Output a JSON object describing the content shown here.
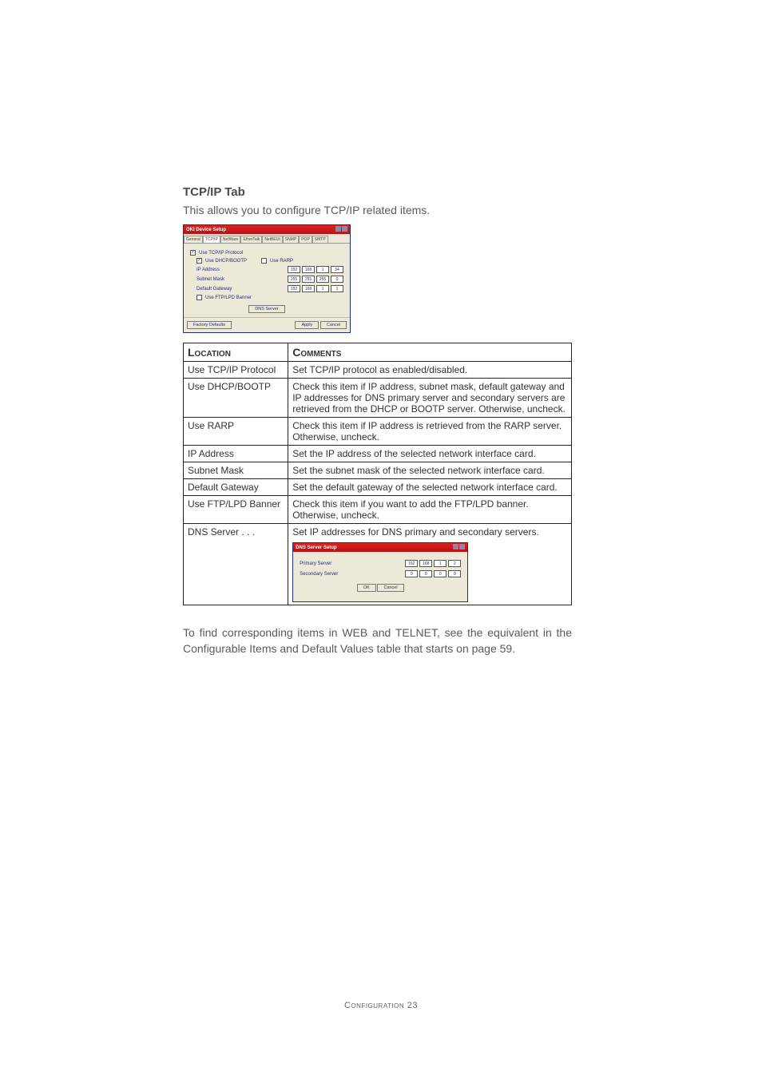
{
  "heading": "TCP/IP Tab",
  "intro": "This allows you to configure TCP/IP related items.",
  "dialog1": {
    "title": "OKI Device Setup",
    "tabs": [
      "General",
      "TCP/IP",
      "NetWare",
      "EtherTalk",
      "NetBEUI",
      "SNMP",
      "POP",
      "SMTP"
    ],
    "active_tab_index": 1,
    "use_tcpip_label": "Use TCP/IP Protocol",
    "use_dhcp_label": "Use DHCP/BOOTP",
    "use_rarp_label": "Use RARP",
    "ip_label": "IP Address",
    "ip": [
      "192",
      "168",
      "1",
      "34"
    ],
    "subnet_label": "Subnet Mask",
    "subnet": [
      "255",
      "255",
      "255",
      "0"
    ],
    "gateway_label": "Default Gateway",
    "gateway": [
      "192",
      "168",
      "1",
      "1"
    ],
    "ftp_lpd_label": "Use FTP/LPD Banner",
    "dns_button": "DNS Server",
    "footer_left": "Factory Defaults",
    "footer_mid": "Apply",
    "footer_right": "Cancel"
  },
  "table_headers": {
    "location": "Location",
    "comments": "Comments"
  },
  "rows": [
    {
      "loc": "Use TCP/IP Protocol",
      "cmt": "Set TCP/IP protocol as enabled/disabled."
    },
    {
      "loc": "Use DHCP/BOOTP",
      "cmt": "Check this item if IP address, subnet mask, default gateway and IP addresses for DNS primary server and secondary servers are retrieved from the DHCP or BOOTP server. Otherwise, uncheck."
    },
    {
      "loc": "Use RARP",
      "cmt": "Check this item if IP address is retrieved from the RARP server. Otherwise, uncheck."
    },
    {
      "loc": "IP Address",
      "cmt": "Set the IP address of the selected network interface card."
    },
    {
      "loc": "Subnet Mask",
      "cmt": "Set the subnet mask of the selected network interface card."
    },
    {
      "loc": "Default Gateway",
      "cmt": "Set the default gateway of the selected network interface card."
    },
    {
      "loc": "Use FTP/LPD Banner",
      "cmt": "Check this item if you want to add the FTP/LPD banner. Otherwise, uncheck."
    },
    {
      "loc": "DNS Server . . .",
      "cmt": "Set IP addresses for DNS primary and secondary servers."
    }
  ],
  "dns_dialog": {
    "title": "DNS Server Setup",
    "primary_label": "Primary Server",
    "primary": [
      "192",
      "168",
      "1",
      "2"
    ],
    "secondary_label": "Secondary Server",
    "secondary": [
      "0",
      "0",
      "0",
      "0"
    ],
    "ok": "OK",
    "cancel": "Cancel"
  },
  "closing": "To find corresponding items in WEB and TELNET, see the equivalent in the Configurable Items and Default Values table that starts on page 59.",
  "footer": "Configuration 23"
}
